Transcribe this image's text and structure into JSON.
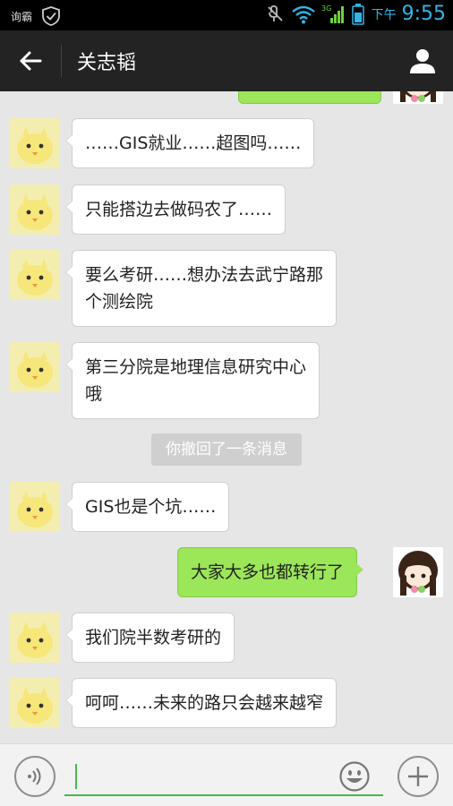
{
  "status_bar": {
    "app_label": "询霸",
    "ampm": "下午",
    "time": "9:55",
    "network": "3G"
  },
  "header": {
    "title": "关志韬"
  },
  "messages": [
    {
      "side": "left",
      "text": "……GIS就业……超图吗……"
    },
    {
      "side": "left",
      "text": "只能搭边去做码农了……"
    },
    {
      "side": "left",
      "lines": [
        "要么考研……想办法去武宁路那",
        "个测绘院"
      ]
    },
    {
      "side": "left",
      "lines": [
        "第三分院是地理信息研究中心",
        "哦"
      ]
    },
    {
      "side": "system",
      "text": "你撤回了一条消息"
    },
    {
      "side": "left",
      "text": "GIS也是个坑……"
    },
    {
      "side": "right",
      "text": "大家大多也都转行了"
    },
    {
      "side": "left",
      "text": "我们院半数考研的"
    },
    {
      "side": "left",
      "text": "呵呵……未来的路只会越来越窄"
    }
  ],
  "colors": {
    "sent_bubble": "#9ce659",
    "accent_green": "#45b94b",
    "time_blue": "#33b5e5"
  },
  "icons": {
    "back": "arrow-left-icon",
    "contact": "person-icon",
    "voice": "voice-icon",
    "emoji": "smiley-icon",
    "more": "plus-icon"
  }
}
